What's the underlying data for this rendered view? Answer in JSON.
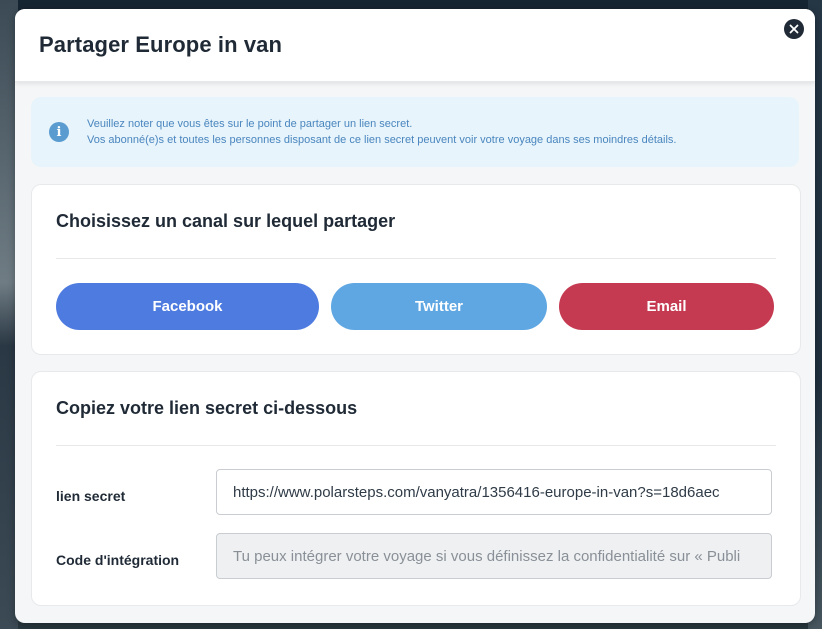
{
  "modal": {
    "title": "Partager Europe in van",
    "close_icon": "close-icon"
  },
  "info": {
    "icon": "info-icon",
    "icon_glyph": "i",
    "line1": "Veuillez noter que vous êtes sur le point de partager un lien secret.",
    "line2": "Vos abonné(e)s et toutes les personnes disposant de ce lien secret peuvent voir votre voyage dans ses moindres détails."
  },
  "share": {
    "title": "Choisissez un canal sur lequel partager",
    "buttons": {
      "facebook": "Facebook",
      "twitter": "Twitter",
      "email": "Email"
    },
    "colors": {
      "facebook": "#4e7be0",
      "twitter": "#5ea7e2",
      "email": "#c53a51"
    }
  },
  "link": {
    "title": "Copiez votre lien secret ci-dessous",
    "secret_label": "lien secret",
    "secret_value": "https://www.polarsteps.com/vanyatra/1356416-europe-in-van?s=18d6aec",
    "embed_label": "Code d'intégration",
    "embed_placeholder": "Tu peux intégrer votre voyage si vous définissez la confidentialité sur « Publi"
  }
}
